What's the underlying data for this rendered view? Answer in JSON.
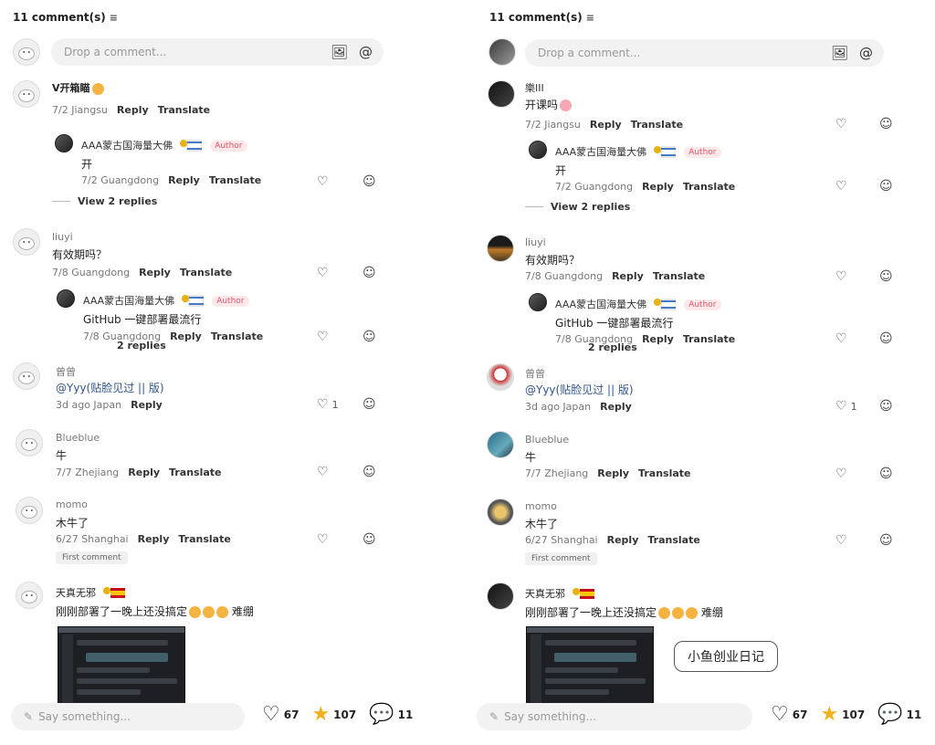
{
  "header": {
    "count_label": "11 comment(s)",
    "filter_icon": "filter-icon"
  },
  "composer": {
    "placeholder": "Drop a comment...",
    "image_icon": "image-icon",
    "mention_icon": "@"
  },
  "comments": [
    {
      "user": "V开箱瞄",
      "text": "",
      "location_date": "7/2 Jiangsu",
      "reply": "Reply",
      "translate": "Translate",
      "user_right": "樂III",
      "text_right": "开课吗",
      "location_date_right": "7/2 Jiangsu"
    },
    {
      "user": "AAA蒙古国海量大佛",
      "badge": "Author",
      "text": "开",
      "location_date": "7/2 Guangdong",
      "reply": "Reply",
      "translate": "Translate"
    },
    {
      "view_replies": "View 2 replies"
    },
    {
      "user": "liuyi",
      "text": "有效期吗？",
      "location_date": "7/8 Guangdong",
      "reply": "Reply",
      "translate": "Translate"
    },
    {
      "user": "AAA蒙古国海量大佛",
      "badge": "Author",
      "text": "GitHub 一键部署最流行",
      "location_date": "7/8 Guangdong",
      "reply": "Reply",
      "translate": "Translate",
      "overlap": "2 replies"
    },
    {
      "user": "曾曾",
      "text": "@Yyy(贴脸见过 || 版)",
      "location_date": "3d ago Japan",
      "reply": "Reply",
      "likes": "1"
    },
    {
      "user": "Blueblue",
      "text": "牛",
      "location_date": "7/7 Zhejiang",
      "reply": "Reply",
      "translate": "Translate"
    },
    {
      "user": "momo",
      "text": "木牛了",
      "location_date": "6/27 Shanghai",
      "reply": "Reply",
      "translate": "Translate",
      "chip": "First comment"
    },
    {
      "user": "天真无邪",
      "text": "刚刚部署了一晚上还没搞定",
      "text_suffix": "难绷"
    }
  ],
  "watermark": "小鱼创业日记",
  "bottom": {
    "placeholder": "Say something...",
    "likes": "67",
    "stars": "107",
    "comments": "11"
  }
}
